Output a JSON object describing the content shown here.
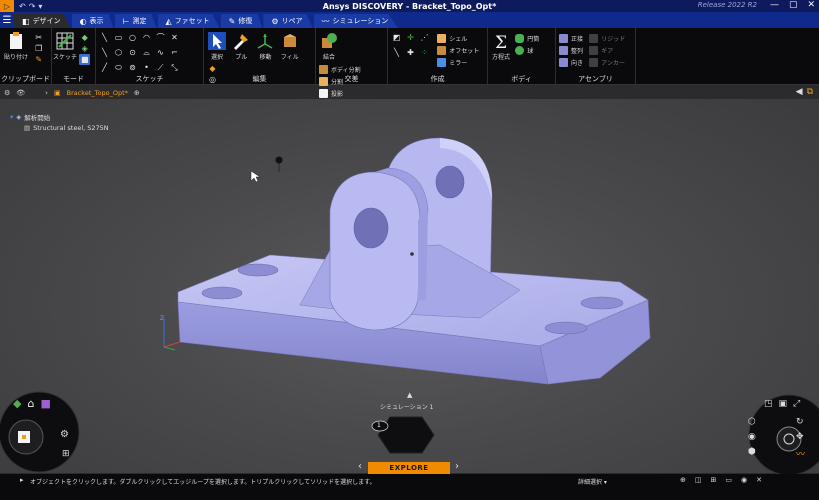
{
  "window": {
    "title": "Ansys DISCOVERY - Bracket_Topo_Opt*",
    "release": "Release 2022 R2"
  },
  "tabs": [
    {
      "label": "デザイン",
      "active": true
    },
    {
      "label": "表示"
    },
    {
      "label": "測定"
    },
    {
      "label": "ファセット"
    },
    {
      "label": "修復"
    },
    {
      "label": "リペア"
    },
    {
      "label": "シミュレーション"
    }
  ],
  "ribbon": {
    "clipboard": {
      "label": "クリップボード",
      "paste": "貼り付け"
    },
    "mode": {
      "label": "モード",
      "sketch": "スケッチ"
    },
    "sketch": {
      "label": "スケッチ"
    },
    "edit": {
      "label": "編集",
      "select": "選択",
      "pull": "プル",
      "move": "移動",
      "fill": "フィル"
    },
    "intersect": {
      "label": "交差",
      "combine": "結合",
      "split_body": "ボディ分割",
      "split": "分割",
      "project": "投影"
    },
    "create": {
      "label": "作成",
      "shell": "シェル",
      "offset": "オフセット",
      "mirror": "ミラー"
    },
    "body": {
      "label": "ボディ",
      "equation": "方程式",
      "cylinder": "円筒",
      "sphere": "球"
    },
    "assembly": {
      "label": "アセンブリ",
      "align": "整列",
      "orient": "向き",
      "anchor": "アンカー",
      "tangent": "正接",
      "rigid": "リジッド",
      "gear": "ギア",
      "mate": "整列"
    }
  },
  "breadcrumb": {
    "document": "Bracket_Topo_Opt*"
  },
  "tree": {
    "root": "解析開始",
    "material": "Structural steel, S275N"
  },
  "simulation": {
    "label": "シミュレーション 1",
    "badge": "1"
  },
  "explore": {
    "label": "EXPLORE"
  },
  "status": {
    "hint": "オブジェクトをクリックします。ダブルクリックしてエッジループを選択します。トリプルクリックしてソリッドを選択します。",
    "mode": "詳細選択"
  },
  "colors": {
    "accent": "#f08a00",
    "titlebar": "#0d1b5e",
    "tabbar": "#0f2a8a",
    "part": "#b3b4ef"
  }
}
